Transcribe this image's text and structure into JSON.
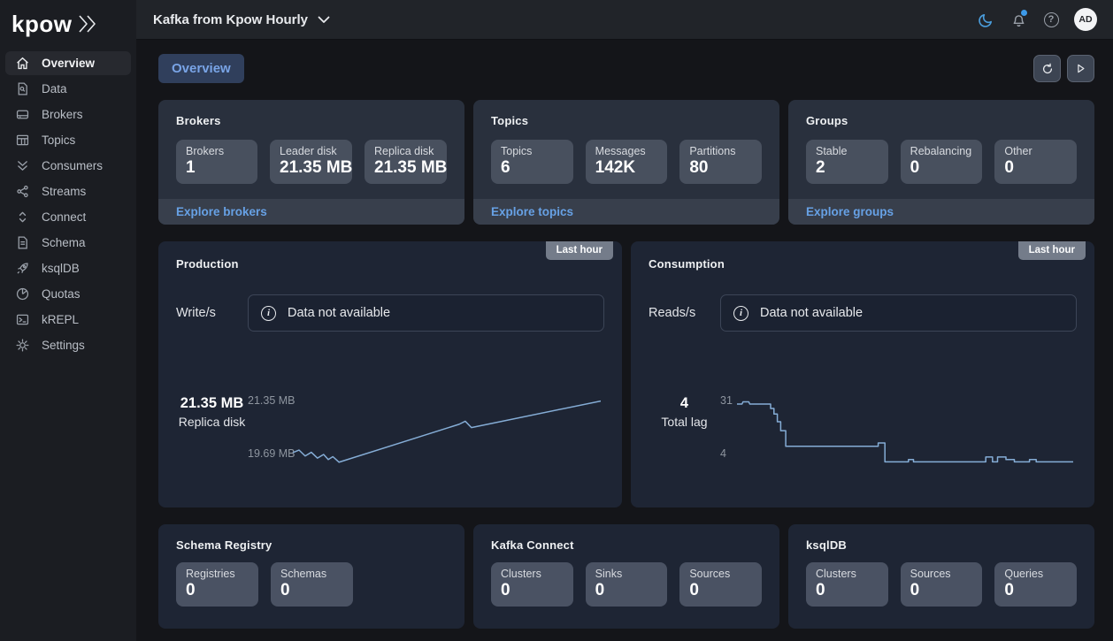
{
  "brand": {
    "logo_text": "kpow"
  },
  "header": {
    "cluster_selector": "Kafka from Kpow Hourly",
    "avatar_initials": "AD"
  },
  "sidebar": {
    "items": [
      {
        "label": "Overview",
        "icon": "home",
        "active": true
      },
      {
        "label": "Data",
        "icon": "document-search",
        "active": false
      },
      {
        "label": "Brokers",
        "icon": "drive",
        "active": false
      },
      {
        "label": "Topics",
        "icon": "table",
        "active": false
      },
      {
        "label": "Consumers",
        "icon": "double-chevron-down",
        "active": false
      },
      {
        "label": "Streams",
        "icon": "share-nodes",
        "active": false
      },
      {
        "label": "Connect",
        "icon": "chevron-up-down",
        "active": false
      },
      {
        "label": "Schema",
        "icon": "document",
        "active": false
      },
      {
        "label": "ksqlDB",
        "icon": "rocket",
        "active": false
      },
      {
        "label": "Quotas",
        "icon": "pie-chart",
        "active": false
      },
      {
        "label": "kREPL",
        "icon": "terminal",
        "active": false
      },
      {
        "label": "Settings",
        "icon": "gear",
        "active": false
      }
    ]
  },
  "toolbar": {
    "active_tab": "Overview"
  },
  "summary_cards": [
    {
      "title": "Brokers",
      "stats": [
        {
          "label": "Brokers",
          "value": "1"
        },
        {
          "label": "Leader disk",
          "value": "21.35 MB"
        },
        {
          "label": "Replica disk",
          "value": "21.35 MB"
        }
      ],
      "footer": "Explore brokers"
    },
    {
      "title": "Topics",
      "stats": [
        {
          "label": "Topics",
          "value": "6"
        },
        {
          "label": "Messages",
          "value": "142K"
        },
        {
          "label": "Partitions",
          "value": "80"
        }
      ],
      "footer": "Explore topics"
    },
    {
      "title": "Groups",
      "stats": [
        {
          "label": "Stable",
          "value": "2"
        },
        {
          "label": "Rebalancing",
          "value": "0"
        },
        {
          "label": "Other",
          "value": "0"
        }
      ],
      "footer": "Explore groups"
    }
  ],
  "monitors": {
    "production": {
      "title": "Production",
      "badge": "Last hour",
      "metric_label": "Write/s",
      "empty": "Data not available",
      "stat_value": "21.35 MB",
      "stat_label": "Replica disk",
      "y_max_label": "21.35 MB",
      "y_min_label": "19.69 MB",
      "chart": {
        "type": "line",
        "min": 19.55,
        "max": 21.45,
        "series": [
          [
            0,
            19.95
          ],
          [
            2,
            20.02
          ],
          [
            4,
            19.86
          ],
          [
            6,
            19.96
          ],
          [
            8,
            19.8
          ],
          [
            10,
            19.9
          ],
          [
            11.5,
            19.76
          ],
          [
            13,
            19.84
          ],
          [
            15,
            19.69
          ],
          [
            54,
            20.72
          ],
          [
            56,
            20.8
          ],
          [
            58,
            20.63
          ],
          [
            100,
            21.35
          ]
        ]
      }
    },
    "consumption": {
      "title": "Consumption",
      "badge": "Last hour",
      "metric_label": "Reads/s",
      "empty": "Data not available",
      "stat_value": "4",
      "stat_label": "Total lag",
      "y_max_label": "31",
      "y_min_label": "4",
      "chart": {
        "type": "line",
        "min": 1.5,
        "max": 33,
        "series": [
          [
            0,
            30
          ],
          [
            1.5,
            30
          ],
          [
            1.8,
            31
          ],
          [
            3.5,
            31
          ],
          [
            3.8,
            30
          ],
          [
            10,
            30
          ],
          [
            10,
            28
          ],
          [
            11,
            28
          ],
          [
            11,
            25.5
          ],
          [
            12,
            25.5
          ],
          [
            12,
            22
          ],
          [
            13,
            22
          ],
          [
            13,
            18
          ],
          [
            14.5,
            18
          ],
          [
            14.5,
            11
          ],
          [
            42,
            11
          ],
          [
            42,
            12.5
          ],
          [
            44,
            12.5
          ],
          [
            44,
            4
          ],
          [
            51,
            4
          ],
          [
            51,
            5
          ],
          [
            52.5,
            5
          ],
          [
            52.5,
            4
          ],
          [
            74,
            4
          ],
          [
            74,
            6.2
          ],
          [
            76,
            6.2
          ],
          [
            76,
            4
          ],
          [
            77.5,
            4
          ],
          [
            77.5,
            6.2
          ],
          [
            80,
            6.2
          ],
          [
            80,
            5
          ],
          [
            82.5,
            5
          ],
          [
            82.5,
            4
          ],
          [
            87,
            4
          ],
          [
            87,
            5
          ],
          [
            89,
            5
          ],
          [
            89,
            4
          ],
          [
            100,
            4
          ]
        ]
      }
    }
  },
  "integration_cards": [
    {
      "title": "Schema Registry",
      "stats": [
        {
          "label": "Registries",
          "value": "0"
        },
        {
          "label": "Schemas",
          "value": "0"
        }
      ]
    },
    {
      "title": "Kafka Connect",
      "stats": [
        {
          "label": "Clusters",
          "value": "0"
        },
        {
          "label": "Sinks",
          "value": "0"
        },
        {
          "label": "Sources",
          "value": "0"
        }
      ]
    },
    {
      "title": "ksqlDB",
      "stats": [
        {
          "label": "Clusters",
          "value": "0"
        },
        {
          "label": "Sources",
          "value": "0"
        },
        {
          "label": "Queries",
          "value": "0"
        }
      ]
    }
  ],
  "colors": {
    "accent_link": "#67a1e5",
    "chart_line": "#85add6",
    "moon": "#4a9ddc",
    "notification_dot": "#3d9ae8",
    "card_light": "#29303d",
    "card_dark": "#1e2534"
  }
}
